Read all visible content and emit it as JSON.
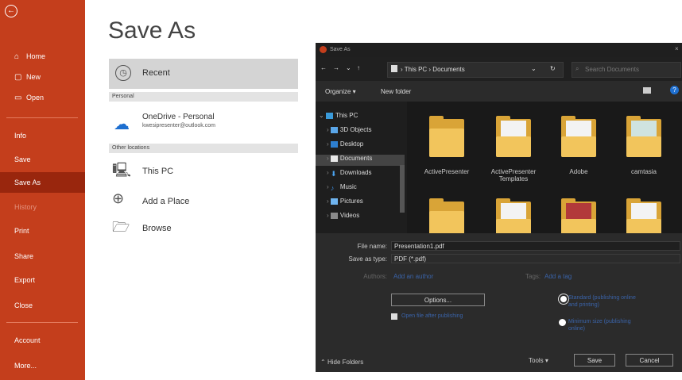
{
  "sidebar": {
    "back_icon": "back-arrow-icon",
    "items": [
      {
        "label": "Home",
        "icon": "home-icon"
      },
      {
        "label": "New",
        "icon": "new-doc-icon"
      },
      {
        "label": "Open",
        "icon": "open-folder-icon"
      },
      {
        "label": "Info"
      },
      {
        "label": "Save"
      },
      {
        "label": "Save As",
        "active": true
      },
      {
        "label": "History",
        "disabled": true
      },
      {
        "label": "Print"
      },
      {
        "label": "Share"
      },
      {
        "label": "Export"
      },
      {
        "label": "Close"
      },
      {
        "label": "Account"
      },
      {
        "label": "More..."
      }
    ]
  },
  "page": {
    "title": "Save As",
    "recent_label": "Recent",
    "personal_header": "Personal",
    "onedrive_label": "OneDrive - Personal",
    "onedrive_email": "kwesipresenter@outlook.com",
    "other_header": "Other locations",
    "thispc_label": "This PC",
    "addplace_label": "Add a Place",
    "browse_label": "Browse"
  },
  "dialog": {
    "title": "Save As",
    "breadcrumb": "› This PC › Documents",
    "search_placeholder": "Search Documents",
    "organize_label": "Organize ▾",
    "newfolder_label": "New folder",
    "tree": [
      {
        "label": "This PC"
      },
      {
        "label": "3D Objects"
      },
      {
        "label": "Desktop"
      },
      {
        "label": "Documents",
        "selected": true
      },
      {
        "label": "Downloads"
      },
      {
        "label": "Music"
      },
      {
        "label": "Pictures"
      },
      {
        "label": "Videos"
      }
    ],
    "folders": [
      {
        "label": "ActivePresenter"
      },
      {
        "label": "ActivePresenter Templates"
      },
      {
        "label": "Adobe"
      },
      {
        "label": "camtasia"
      }
    ],
    "filename_label": "File name:",
    "filename_value": "Presentation1.pdf",
    "savetype_label": "Save as type:",
    "savetype_value": "PDF (*.pdf)",
    "authors_label": "Authors:",
    "authors_value": "Add an author",
    "tags_label": "Tags:",
    "tags_value": "Add a tag",
    "options_label": "Options...",
    "open_after_label": "Open file after publishing",
    "opt_standard": "Standard (publishing online and printing)",
    "opt_minimum": "Minimum size (publishing online)",
    "hide_folders": "Hide Folders",
    "tools_label": "Tools ▾",
    "save_label": "Save",
    "cancel_label": "Cancel"
  }
}
